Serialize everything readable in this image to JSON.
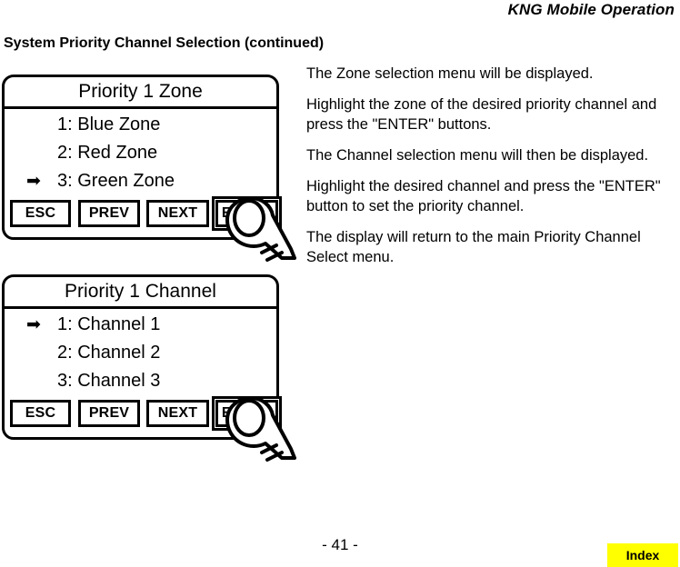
{
  "header": {
    "running_title": "KNG Mobile Operation"
  },
  "section": {
    "title": "System Priority Channel Selection (continued)"
  },
  "panels": [
    {
      "id": "zone",
      "title": "Priority 1 Zone",
      "rows": [
        {
          "label": "1: Blue Zone",
          "marker": "",
          "selected": false
        },
        {
          "label": "2: Red Zone",
          "marker": "",
          "selected": false
        },
        {
          "label": "3: Green Zone",
          "marker": "➡",
          "selected": true
        }
      ],
      "softkeys": [
        {
          "label": "ESC",
          "emphasized": false
        },
        {
          "label": "PREV",
          "emphasized": false
        },
        {
          "label": "NEXT",
          "emphasized": false
        },
        {
          "label": "ENTER",
          "emphasized": true
        }
      ]
    },
    {
      "id": "channel",
      "title": "Priority 1 Channel",
      "rows": [
        {
          "label": "1: Channel 1",
          "marker": "➡",
          "selected": true
        },
        {
          "label": "2: Channel 2",
          "marker": "",
          "selected": false
        },
        {
          "label": "3: Channel 3",
          "marker": "",
          "selected": false
        }
      ],
      "softkeys": [
        {
          "label": "ESC",
          "emphasized": false
        },
        {
          "label": "PREV",
          "emphasized": false
        },
        {
          "label": "NEXT",
          "emphasized": false
        },
        {
          "label": "ENTER",
          "emphasized": true
        }
      ]
    }
  ],
  "instructions": [
    "The Zone selection menu will be displayed.",
    "Highlight the zone of the desired priority channel and press the \"ENTER\" buttons.",
    "The Channel selection menu will then be displayed.",
    "Highlight the desired channel and press the \"ENTER\" button to set the priority channel.",
    "The display will return to the main Priority Channel Select menu."
  ],
  "footer": {
    "page_number": "- 41 -",
    "index_label": "Index",
    "index_color": "#ffff00"
  },
  "icons": {
    "selection_arrow": "right-arrow-icon",
    "pointing_finger": "pointing-finger-icon"
  }
}
